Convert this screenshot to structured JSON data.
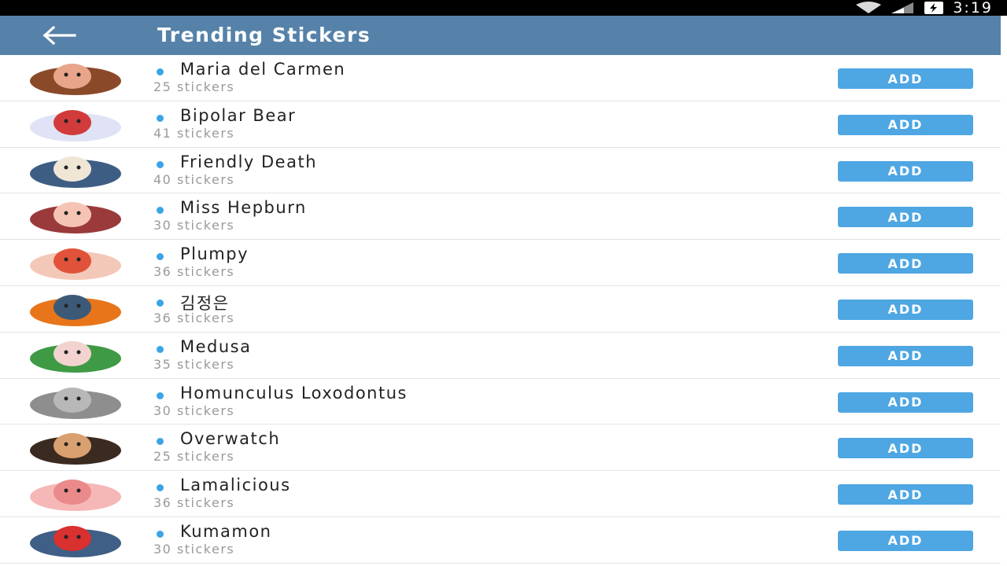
{
  "status_bar": {
    "time": "3:19",
    "icons": [
      "wifi-icon",
      "signal-icon",
      "battery-icon"
    ]
  },
  "app_bar": {
    "title": "Trending Stickers",
    "back_icon": "arrow-left-icon",
    "color": "#5682a9"
  },
  "colors": {
    "accent_dot": "#3aa4e6",
    "add_button": "#4ea6e2",
    "count_text": "#9a9a9a"
  },
  "sticker_packs": [
    {
      "name": "Maria del Carmen",
      "count": "25 stickers",
      "button": "ADD",
      "thumb": "curly-hair-woman-sticker",
      "c1": "#8a4a2a",
      "c2": "#e8a58a"
    },
    {
      "name": "Bipolar Bear",
      "count": "41 stickers",
      "button": "ADD",
      "thumb": "white-bear-sticker",
      "c1": "#dfe3f5",
      "c2": "#d23b3b"
    },
    {
      "name": "Friendly Death",
      "count": "40 stickers",
      "button": "ADD",
      "thumb": "grim-reaper-sticker",
      "c1": "#3e5d83",
      "c2": "#f0e6d6"
    },
    {
      "name": "Miss Hepburn",
      "count": "30 stickers",
      "button": "ADD",
      "thumb": "lady-sticker",
      "c1": "#9a3a3a",
      "c2": "#f6c4b5"
    },
    {
      "name": "Plumpy",
      "count": "36 stickers",
      "button": "ADD",
      "thumb": "plump-character-sticker",
      "c1": "#f4c8b8",
      "c2": "#e0533a"
    },
    {
      "name": "김정은",
      "count": "36 stickers",
      "button": "ADD",
      "thumb": "fire-scene-sticker",
      "c1": "#e8751a",
      "c2": "#3c5a78"
    },
    {
      "name": "Medusa",
      "count": "35 stickers",
      "button": "ADD",
      "thumb": "medusa-sticker",
      "c1": "#3f9a45",
      "c2": "#f2d3d0"
    },
    {
      "name": "Homunculus Loxodontus",
      "count": "30 stickers",
      "button": "ADD",
      "thumb": "grey-elephant-sticker",
      "c1": "#8e8e8e",
      "c2": "#b8b8b8"
    },
    {
      "name": "Overwatch",
      "count": "25 stickers",
      "button": "ADD",
      "thumb": "bearded-hero-sticker",
      "c1": "#3b2a20",
      "c2": "#d9a070"
    },
    {
      "name": "Lamalicious",
      "count": "36 stickers",
      "button": "ADD",
      "thumb": "pink-llama-sticker",
      "c1": "#f6b7b7",
      "c2": "#ea8a8a"
    },
    {
      "name": "Kumamon",
      "count": "30 stickers",
      "button": "ADD",
      "thumb": "blue-bear-sticker",
      "c1": "#3f5f86",
      "c2": "#d93030"
    }
  ]
}
